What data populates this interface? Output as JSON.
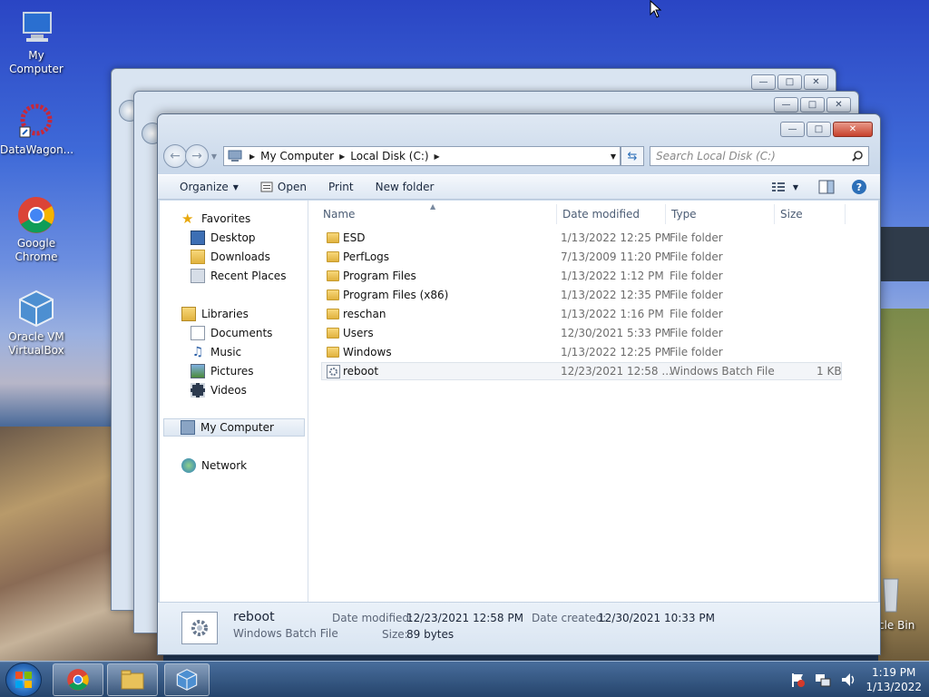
{
  "desktop": {
    "icons": [
      {
        "label": "My Computer",
        "name": "my-computer-desktop-icon"
      },
      {
        "label": "DataWagon...",
        "name": "datawagon-desktop-icon"
      },
      {
        "label": "Google Chrome",
        "name": "chrome-desktop-icon"
      },
      {
        "label": "Oracle VM VirtualBox",
        "name": "virtualbox-desktop-icon"
      }
    ],
    "recycle_label": "cle Bin"
  },
  "window": {
    "address": {
      "crumbs": [
        "My Computer",
        "Local Disk (C:)"
      ]
    },
    "search": {
      "placeholder": "Search Local Disk (C:)"
    },
    "toolbar": {
      "organize": "Organize",
      "open": "Open",
      "print": "Print",
      "new_folder": "New folder"
    },
    "nav": {
      "favorites": "Favorites",
      "desktop": "Desktop",
      "downloads": "Downloads",
      "recent": "Recent Places",
      "libraries": "Libraries",
      "documents": "Documents",
      "music": "Music",
      "pictures": "Pictures",
      "videos": "Videos",
      "my_computer": "My Computer",
      "network": "Network"
    },
    "columns": {
      "name": "Name",
      "date": "Date modified",
      "type": "Type",
      "size": "Size"
    },
    "files": [
      {
        "name": "ESD",
        "date": "1/13/2022 12:25 PM",
        "type": "File folder",
        "size": ""
      },
      {
        "name": "PerfLogs",
        "date": "7/13/2009 11:20 PM",
        "type": "File folder",
        "size": ""
      },
      {
        "name": "Program Files",
        "date": "1/13/2022 1:12 PM",
        "type": "File folder",
        "size": ""
      },
      {
        "name": "Program Files (x86)",
        "date": "1/13/2022 12:35 PM",
        "type": "File folder",
        "size": ""
      },
      {
        "name": "reschan",
        "date": "1/13/2022 1:16 PM",
        "type": "File folder",
        "size": ""
      },
      {
        "name": "Users",
        "date": "12/30/2021 5:33 PM",
        "type": "File folder",
        "size": ""
      },
      {
        "name": "Windows",
        "date": "1/13/2022 12:25 PM",
        "type": "File folder",
        "size": ""
      },
      {
        "name": "reboot",
        "date": "12/23/2021 12:58 ...",
        "type": "Windows Batch File",
        "size": "1 KB"
      }
    ],
    "details": {
      "name": "reboot",
      "type": "Windows Batch File",
      "modified_label": "Date modified:",
      "modified_value": "12/23/2021 12:58 PM",
      "created_label": "Date created:",
      "created_value": "12/30/2021 10:33 PM",
      "size_label": "Size:",
      "size_value": "89 bytes"
    }
  },
  "taskbar": {
    "time": "1:19 PM",
    "date": "1/13/2022"
  },
  "colors": {
    "accent": "#2c6fb8",
    "selection": "#dde7f2"
  }
}
